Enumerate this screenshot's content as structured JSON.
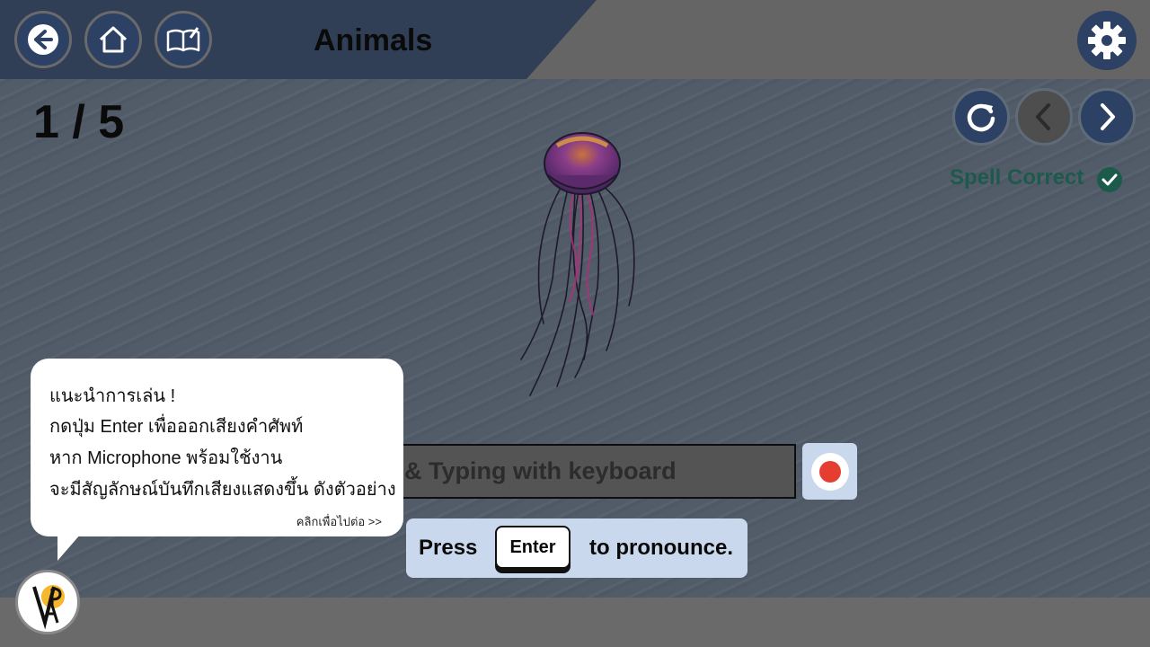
{
  "header": {
    "title": "Animals",
    "back_icon": "arrow-left-icon",
    "home_icon": "home-icon",
    "book_icon": "book-edit-icon",
    "settings_icon": "gear-icon"
  },
  "progress": {
    "current": "1",
    "separator": " / ",
    "total": "5"
  },
  "nav": {
    "reload_icon": "reload-icon",
    "prev_icon": "chevron-left-icon",
    "next_icon": "chevron-right-icon"
  },
  "status": {
    "label": "Spell Correct",
    "icon": "check-circle-icon"
  },
  "answer_input": {
    "value": "",
    "placeholder": "Click & Typing with keyboard"
  },
  "record_button": {
    "icon": "record-icon"
  },
  "hint": {
    "before": "Press",
    "key": "Enter",
    "after": "to pronounce."
  },
  "tutorial": {
    "lines": [
      "แนะนำการเล่น !",
      "กดปุ่ม Enter เพื่อออกเสียงคำศัพท์",
      "หาก Microphone พร้อมใช้งาน",
      "จะมีสัญลักษณ์บันทึกเสียงแสดงขึ้น ดังตัวอย่าง"
    ],
    "continue": "คลิกเพื่อไปต่อ >>"
  },
  "colors": {
    "header_blue": "#313f56",
    "button_blue": "#2c4163",
    "status_green": "#1d5a4c",
    "record_red": "#e53d2f",
    "hint_bg": "#c9d8ec"
  }
}
